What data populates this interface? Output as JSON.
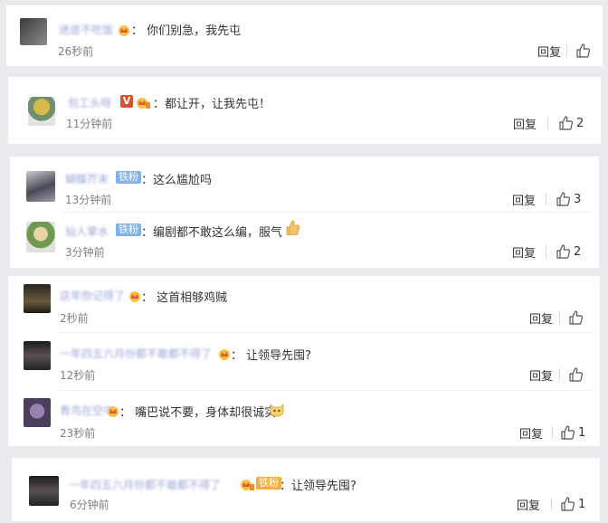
{
  "cards": [
    {
      "comments": [
        {
          "text": "：  你们别急，我先屯",
          "time": "26秒前",
          "reply": "回复",
          "likes": ""
        }
      ]
    },
    {
      "comments": [
        {
          "text": "：都让开，让我先屯！",
          "time": "11分钟前",
          "reply": "回复",
          "likes": "2"
        }
      ]
    },
    {
      "comments": [
        {
          "text": "：这么尴尬吗",
          "time": "13分钟前",
          "reply": "回复",
          "likes": "3",
          "fan": "铁粉"
        },
        {
          "text": "：编剧都不敢这么编，服气",
          "time": "3分钟前",
          "reply": "回复",
          "likes": "2",
          "fan": "铁粉"
        }
      ]
    },
    {
      "comments": [
        {
          "text": "：  这首相够鸡贼",
          "time": "2秒前",
          "reply": "回复",
          "likes": ""
        },
        {
          "text": "：  让领导先囤?",
          "time": "12秒前",
          "reply": "回复",
          "likes": ""
        },
        {
          "text": "：  嘴巴说不要，身体却很诚实",
          "time": "23秒前",
          "reply": "回复",
          "likes": "1"
        }
      ]
    },
    {
      "comments": [
        {
          "text": "：让领导先囤?",
          "time": "6分钟前",
          "reply": "回复",
          "likes": "1",
          "fan": "铁粉"
        }
      ]
    }
  ],
  "names": {
    "n0": "迷途不吃饭",
    "n1": "包工头呀",
    "n2": "蝴蝶芥末",
    "n3": "仙人掌水",
    "n4": "这年你记得了",
    "n5": "一年四五六月份都不敢都不得了",
    "n6": "青鸟在空中",
    "n7": "一年四五六月份都不敢都不得了"
  },
  "badges": {
    "v": "V"
  },
  "colors": {
    "fan_blue": "#7fb3e9",
    "fan_gold": "#f3b13c",
    "vip": "#d9532b"
  }
}
